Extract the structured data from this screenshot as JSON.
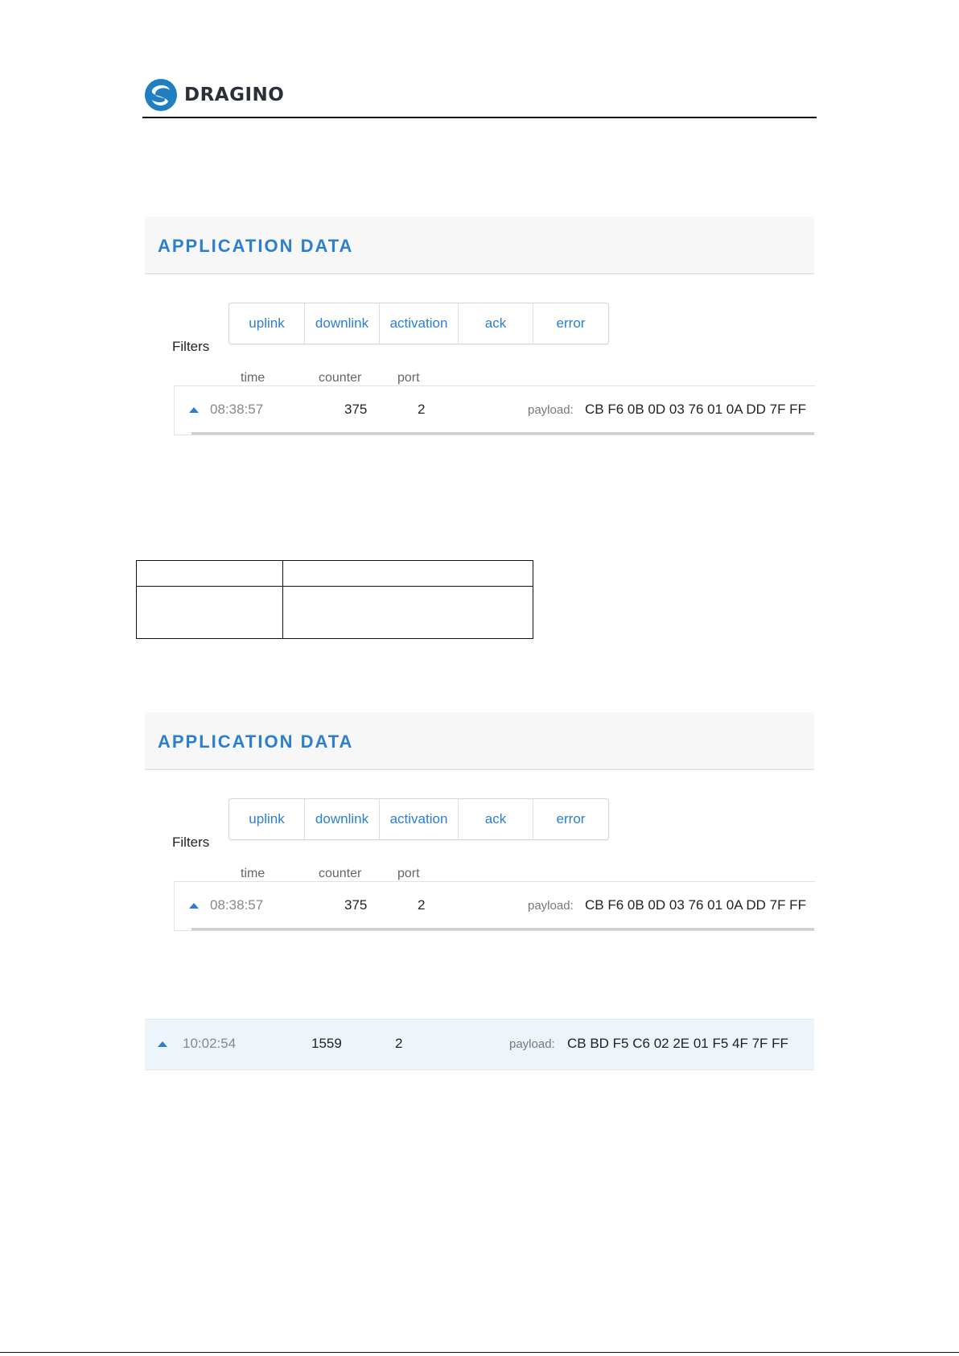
{
  "header": {
    "brand": "DRAGINO",
    "logo_icon": "dragino-swirl-logo"
  },
  "panels": [
    {
      "title": "APPLICATION DATA",
      "filters_label": "Filters",
      "filters": [
        "uplink",
        "downlink",
        "activation",
        "ack",
        "error"
      ],
      "columns": {
        "time": "time",
        "counter": "counter",
        "port": "port"
      },
      "row": {
        "time": "08:38:57",
        "counter": "375",
        "port": "2",
        "payload_label": "payload:",
        "payload": "CB F6 0B 0D 03 76 01 0A DD 7F FF"
      }
    },
    {
      "title": "APPLICATION DATA",
      "filters_label": "Filters",
      "filters": [
        "uplink",
        "downlink",
        "activation",
        "ack",
        "error"
      ],
      "columns": {
        "time": "time",
        "counter": "counter",
        "port": "port"
      },
      "row": {
        "time": "08:38:57",
        "counter": "375",
        "port": "2",
        "payload_label": "payload:",
        "payload": "CB F6 0B 0D 03 76 01 0A DD 7F FF"
      }
    }
  ],
  "row_strip": {
    "time": "10:02:54",
    "counter": "1559",
    "port": "2",
    "payload_label": "payload:",
    "payload": "CB BD F5 C6 02 2E 01 F5 4F 7F FF"
  },
  "colors": {
    "accent": "#2a7fd0",
    "header_bg": "#f7f7f7",
    "strip_bg": "#eef5fa"
  }
}
